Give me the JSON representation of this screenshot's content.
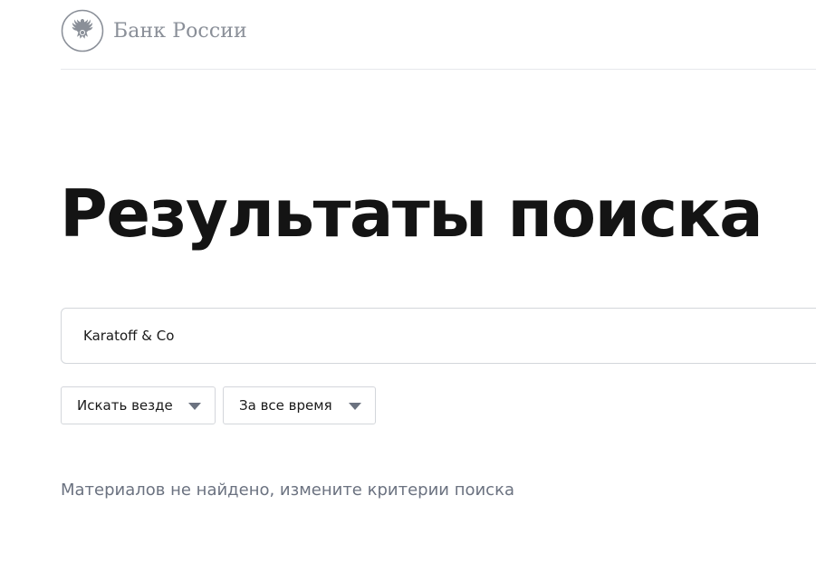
{
  "header": {
    "logo_text": "Банк России",
    "logo_icon": "double-headed-eagle-emblem"
  },
  "page": {
    "title": "Результаты поиска"
  },
  "search": {
    "value": "Karatoff & Co"
  },
  "filters": {
    "scope_label": "Искать везде",
    "period_label": "За все время"
  },
  "results": {
    "empty_message": "Материалов не найдено, измените критерии поиска"
  },
  "colors": {
    "text_primary": "#141414",
    "text_muted": "#6b7280",
    "logo_gray": "#8a8f98",
    "border": "#d3d6db",
    "arrow": "#6b7280"
  }
}
